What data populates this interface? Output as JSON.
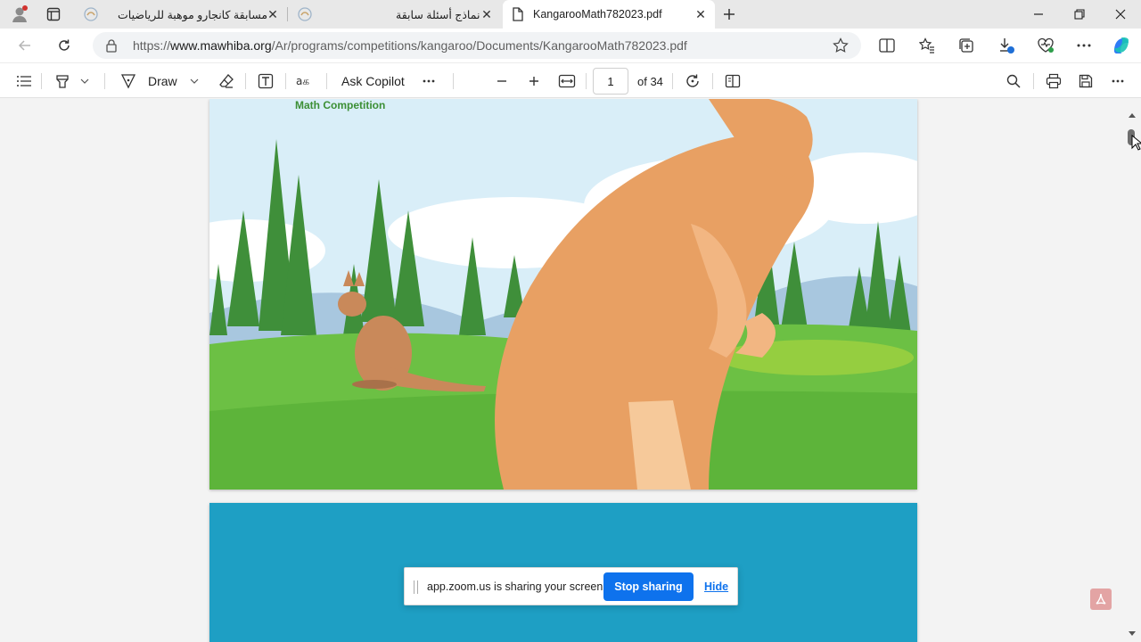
{
  "tabs": [
    {
      "label": "مسابقة كانجارو موهبة للرياضيات",
      "active": false
    },
    {
      "label": "نماذج أسئلة سابقة",
      "active": false
    },
    {
      "label": "KangarooMath782023.pdf",
      "active": true
    }
  ],
  "address": {
    "scheme": "https://",
    "host": "www.mawhiba.org",
    "path": "/Ar/programs/competitions/kangaroo/Documents/KangarooMath782023.pdf"
  },
  "pdf_toolbar": {
    "draw_label": "Draw",
    "copilot_label": "Ask Copilot",
    "page_current": "1",
    "page_total": "of 34"
  },
  "document": {
    "competition_title": "Math Competition"
  },
  "zoom_share": {
    "message": "app.zoom.us is sharing your screen.",
    "stop_label": "Stop sharing",
    "hide_label": "Hide"
  },
  "colors": {
    "accent": "#0e72ed",
    "page2_bg": "#1e9fc4",
    "grass": "#6cc044",
    "kangaroo": "#e8a063"
  }
}
